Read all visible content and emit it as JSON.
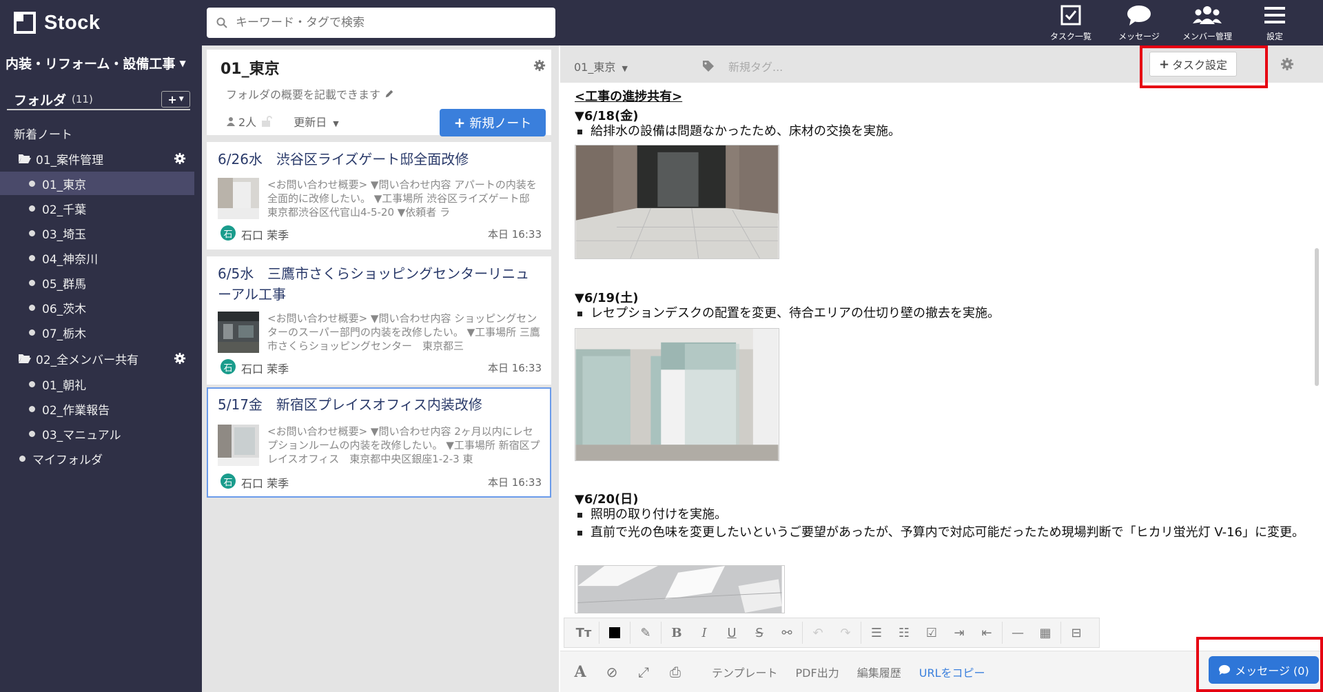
{
  "app": {
    "name": "Stock"
  },
  "search": {
    "placeholder": "キーワード・タグで検索"
  },
  "nav": {
    "tasks": "タスク一覧",
    "messages": "メッセージ",
    "members": "メンバー管理",
    "settings": "設定"
  },
  "sidebar": {
    "workspace": "内装・リフォーム・設備工事",
    "folder_label": "フォルダ",
    "folder_count": "(11)",
    "new_notes": "新着ノート",
    "groups": [
      {
        "label": "01_案件管理",
        "items": [
          "01_東京",
          "02_千葉",
          "03_埼玉",
          "04_神奈川",
          "05_群馬",
          "06_茨木",
          "07_栃木"
        ]
      },
      {
        "label": "02_全メンバー共有",
        "items": [
          "01_朝礼",
          "02_作業報告",
          "03_マニュアル"
        ]
      }
    ],
    "my_folder": "マイフォルダ"
  },
  "folder": {
    "title": "01_東京",
    "description": "フォルダの概要を記載できます",
    "members": "2人",
    "sort": "更新日",
    "new_note_button": "新規ノート"
  },
  "notes": [
    {
      "title": "6/26水　渋谷区ライズゲート邸全面改修",
      "excerpt": "<お問い合わせ概要> ▼問い合わせ内容 アパートの内装を全面的に改修したい。 ▼工事場所 渋谷区ライズゲート邸　東京都渋谷区代官山4-5-20 ▼依頼者 ラ",
      "avatar": "石",
      "author": "石口 茉季",
      "time": "本日 16:33"
    },
    {
      "title": "6/5水　三鷹市さくらショッピングセンターリニューアル工事",
      "excerpt": "<お問い合わせ概要> ▼問い合わせ内容 ショッピングセンターのスーパー部門の内装を改修したい。 ▼工事場所 三鷹市さくらショッピングセンター　東京都三",
      "avatar": "石",
      "author": "石口 茉季",
      "time": "本日 16:33"
    },
    {
      "title": "5/17金　新宿区プレイスオフィス内装改修",
      "excerpt": "<お問い合わせ概要> ▼問い合わせ内容 2ヶ月以内にレセプションルームの内装を改修したい。 ▼工事場所 新宿区プレイスオフィス　東京都中央区銀座1-2-3 東",
      "avatar": "石",
      "author": "石口 茉季",
      "time": "本日 16:33"
    }
  ],
  "editor": {
    "folder": "01_東京",
    "tag_placeholder": "新規タグ...",
    "task_button": "タスク設定",
    "heading": "<工事の進捗共有>",
    "entries": [
      {
        "date": "▼6/18(金)",
        "bullets": [
          "給排水の設備は問題なかったため、床材の交換を実施。"
        ]
      },
      {
        "date": "▼6/19(土)",
        "bullets": [
          "レセプションデスクの配置を変更、待合エリアの仕切り壁の撤去を実施。"
        ]
      },
      {
        "date": "▼6/20(日)",
        "bullets": [
          "照明の取り付けを実施。",
          "直前で光の色味を変更したいというご要望があったが、予算内で対応可能だったため現場判断で「ヒカリ蛍光灯 V-16」に変更。"
        ]
      }
    ]
  },
  "bottom": {
    "template": "テンプレート",
    "pdf": "PDF出力",
    "history": "編集履歴",
    "copy_url": "URLをコピー",
    "message_button": "メッセージ (0)"
  }
}
